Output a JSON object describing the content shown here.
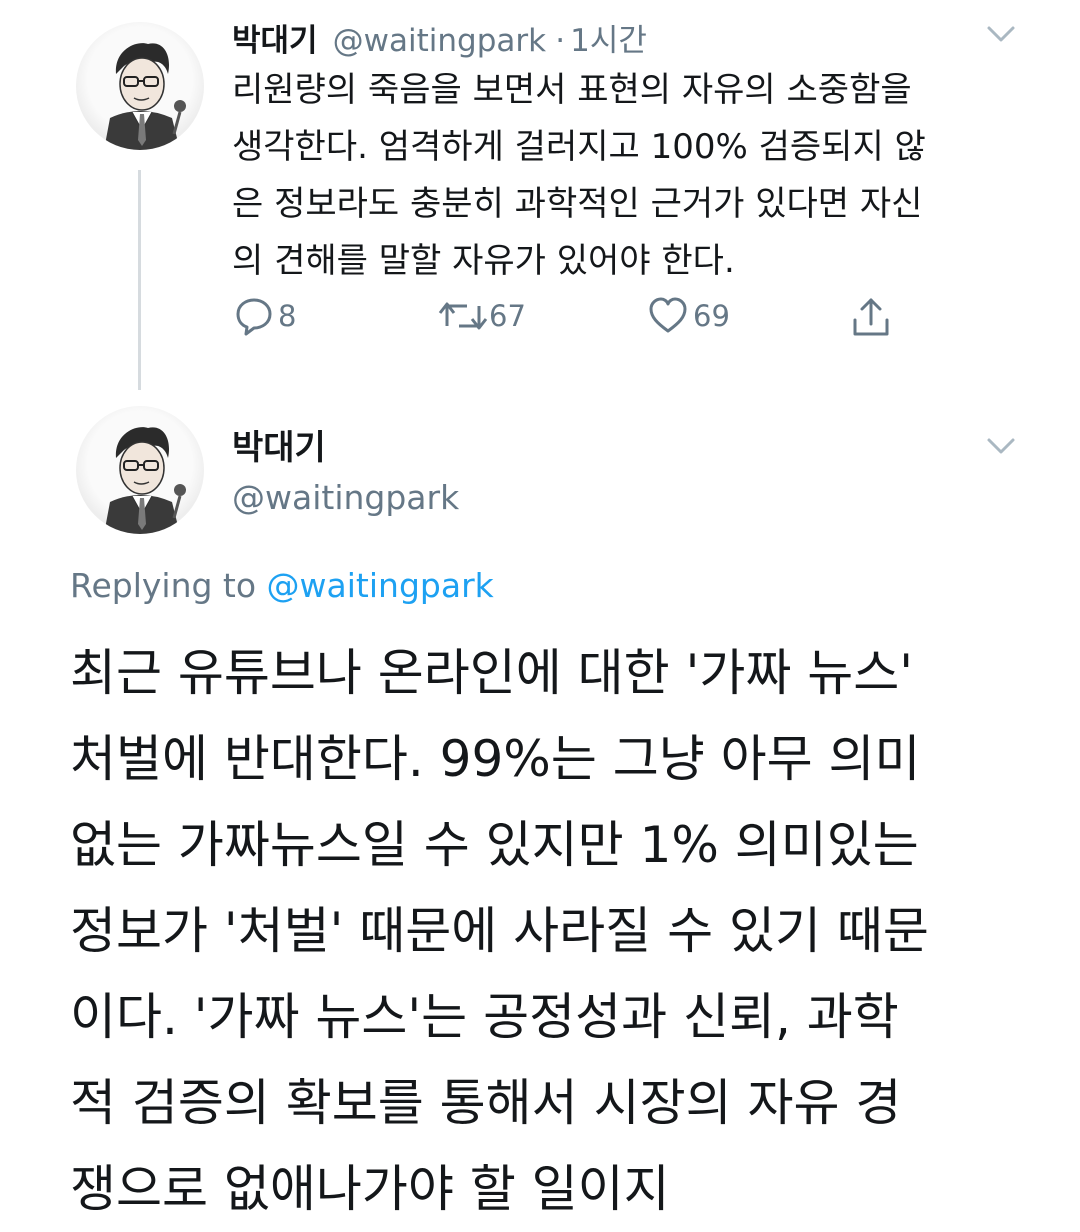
{
  "parent_tweet": {
    "display_name": "박대기",
    "handle": "@waitingpark",
    "separator": "·",
    "time_ago": "1시간",
    "text_lines": [
      "리원량의 죽음을 보면서 표현의 자유의 소중함을",
      "생각한다. 엄격하게 걸러지고 100% 검증되지 않",
      "은 정보라도 충분히 과학적인 근거가 있다면 자신",
      "의 견해를 말할 자유가 있어야 한다."
    ],
    "actions": {
      "reply_count": "8",
      "retweet_count": "67",
      "like_count": "69"
    },
    "icons": [
      "reply-icon",
      "retweet-icon",
      "like-icon",
      "share-icon",
      "chevron-down-icon"
    ]
  },
  "main_tweet": {
    "display_name": "박대기",
    "handle": "@waitingpark",
    "replying_prefix": "Replying to",
    "replying_to": "@waitingpark",
    "text_lines": [
      "최근 유튜브나 온라인에 대한 '가짜 뉴스'",
      "처벌에 반대한다. 99%는 그냥 아무 의미",
      "없는 가짜뉴스일 수 있지만 1% 의미있는",
      "정보가 '처벌' 때문에 사라질 수 있기 때문",
      "이다. '가짜 뉴스'는 공정성과 신뢰, 과학",
      "적 검증의 확보를 통해서 시장의 자유 경",
      "쟁으로 없애나가야 할 일이지"
    ]
  },
  "colors": {
    "text": "#14171a",
    "secondary": "#657786",
    "link": "#1da1f2",
    "thread_line": "#d6dbdf"
  }
}
